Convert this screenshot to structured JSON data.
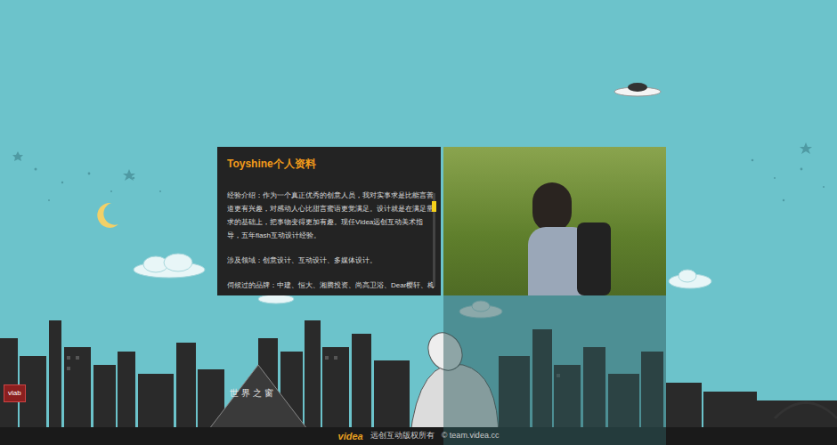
{
  "profile": {
    "title": "Toyshine个人资料",
    "paragraphs": [
      "经验介绍：作为一个真正优秀的创意人员，我对实事求是比能言善道更有兴趣，对感动人心比甜言蜜语更觉满足。设计就是在满足需求的基础上，把事物变得更加有趣。现任Videa远创互动美术指导，五年flash互动设计经验。",
      "涉及领域：创意设计、互动设计、多媒体设计。",
      "伺候过的品牌：中建、恒大、湘腾投资、尚高卫浴、Dear樱轩、梅"
    ],
    "scroll": {
      "level": 0.1
    }
  },
  "landmark": "世界之窗",
  "badge": "vlab",
  "footer": {
    "logo": "videa",
    "copyright": "远创互动版权所有",
    "site": "© team.videa.cc"
  }
}
